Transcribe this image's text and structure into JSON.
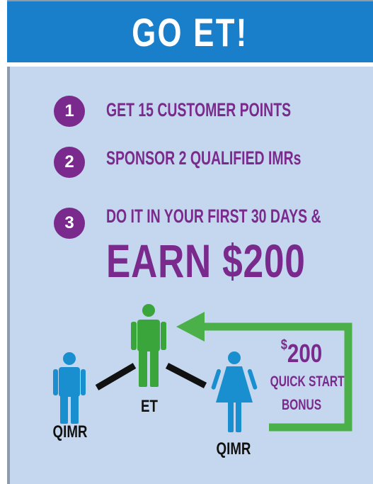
{
  "header": {
    "title": "GO ET!"
  },
  "steps": [
    {
      "number": "1",
      "text": "GET 15 CUSTOMER POINTS"
    },
    {
      "number": "2",
      "text": "SPONSOR 2 QUALIFIED IMRs"
    },
    {
      "number": "3",
      "text": "DO IT IN YOUR FIRST 30 DAYS &"
    }
  ],
  "earn": {
    "text": "EARN $200"
  },
  "diagram": {
    "left_person_label": "QIMR",
    "center_person_label": "ET",
    "right_person_label": "QIMR",
    "bonus": {
      "currency": "$",
      "amount": "200",
      "line1": "QUICK START",
      "line2": "BONUS"
    }
  },
  "colors": {
    "header_bg": "#1a7fcb",
    "card_bg": "#c5d7ee",
    "purple": "#7a2a8c",
    "green_person": "#3aa53a",
    "blue_person": "#1a8fd0",
    "arrow_green": "#4bb04a"
  }
}
